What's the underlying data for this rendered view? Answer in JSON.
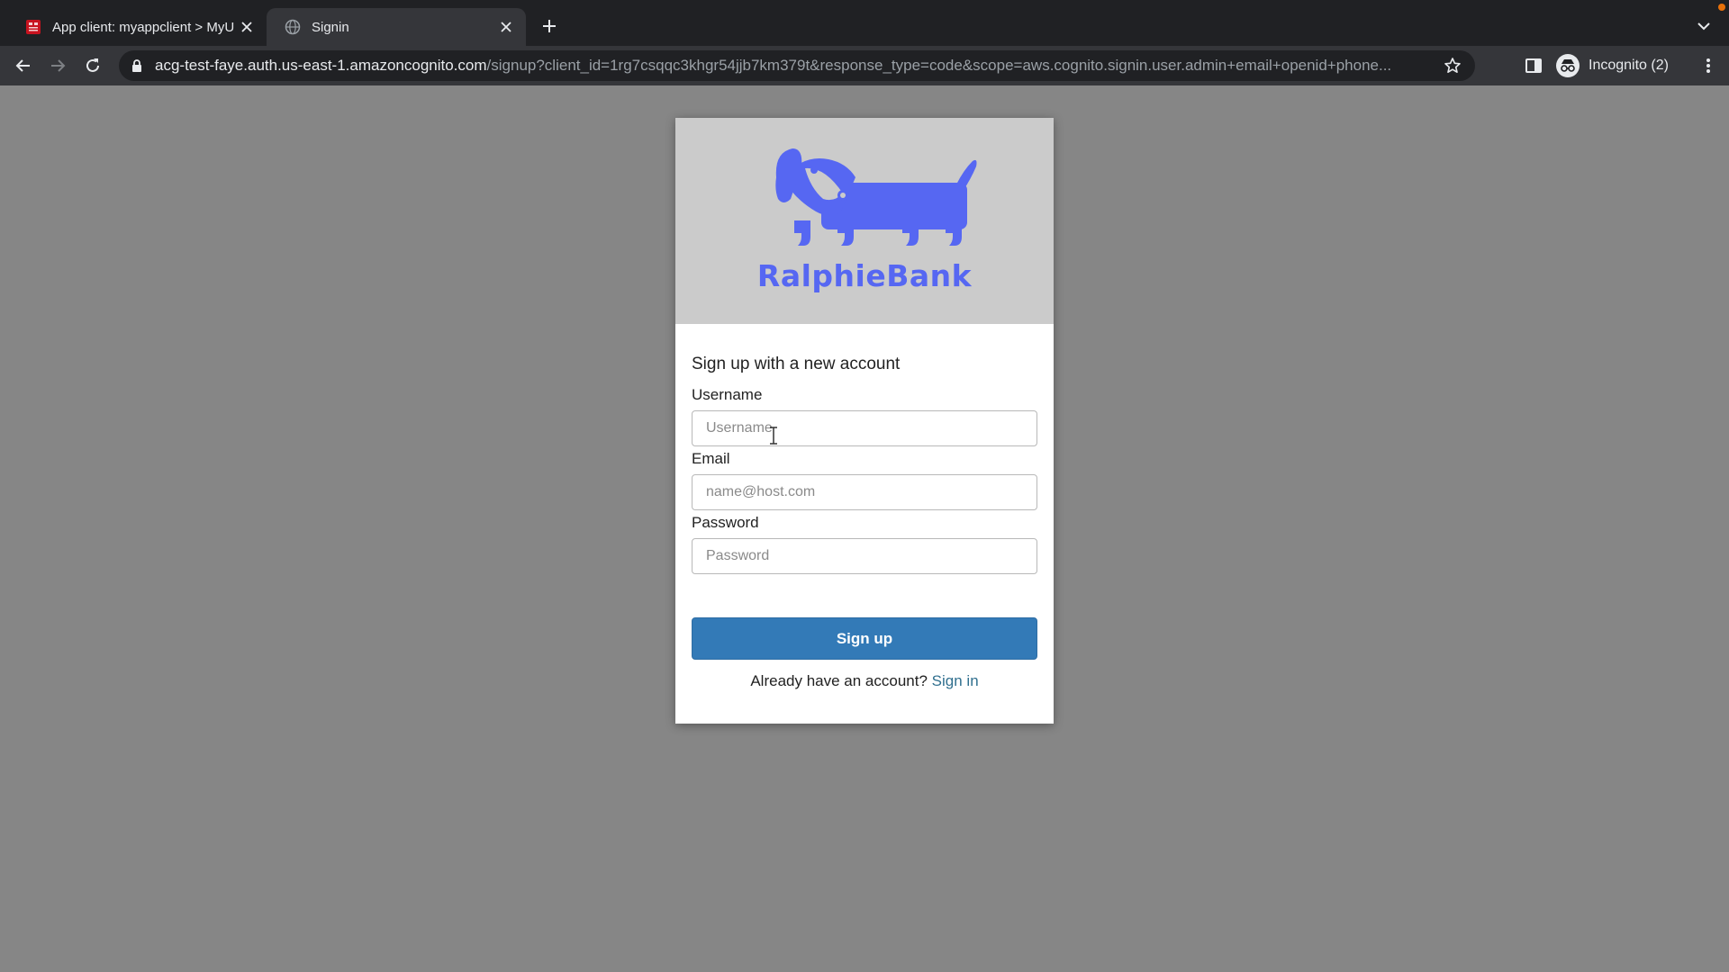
{
  "browser": {
    "tabs": [
      {
        "title": "App client: myappclient > MyU",
        "active": false
      },
      {
        "title": "Signin",
        "active": true
      }
    ],
    "url_host": "acg-test-faye.auth.us-east-1.amazoncognito.com",
    "url_path": "/signup?client_id=1rg7csqqc3khgr54jjb7km379t&response_type=code&scope=aws.cognito.signin.user.admin+email+openid+phone...",
    "profile_label": "Incognito (2)"
  },
  "brand": {
    "name": "RalphieBank",
    "color": "#5667f2",
    "banner_color": "#cbcbcb"
  },
  "form": {
    "heading": "Sign up with a new account",
    "username_label": "Username",
    "username_placeholder": "Username",
    "email_label": "Email",
    "email_placeholder": "name@host.com",
    "password_label": "Password",
    "password_placeholder": "Password",
    "submit_label": "Sign up",
    "signin_prompt": "Already have an account?",
    "signin_link": "Sign in",
    "accent_color": "#337ab7"
  },
  "icons": [
    "aws-favicon",
    "globe-icon",
    "close-icon",
    "plus-icon",
    "chevron-down-icon",
    "back-arrow-icon",
    "forward-arrow-icon",
    "reload-icon",
    "lock-icon",
    "star-icon",
    "side-panel-icon",
    "incognito-icon",
    "kebab-menu-icon",
    "text-cursor-icon",
    "dog-logo"
  ]
}
